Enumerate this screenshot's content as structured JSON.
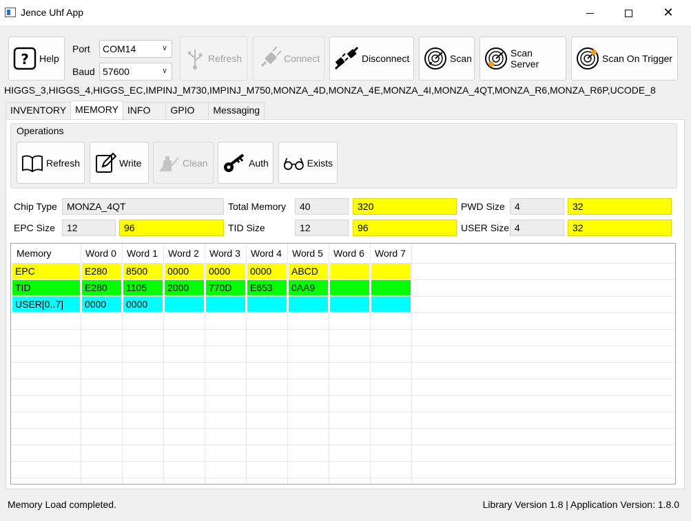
{
  "window": {
    "title": "Jence Uhf App"
  },
  "toolbar": {
    "help_label": "Help",
    "port_label": "Port",
    "port_value": "COM14",
    "baud_label": "Baud",
    "baud_value": "57600",
    "refresh_label": "Refresh",
    "connect_label": "Connect",
    "disconnect_label": "Disconnect",
    "scan_label": "Scan",
    "scan_server_label": "Scan Server",
    "scan_trigger_label": "Scan On Trigger"
  },
  "supported_chips": "HIGGS_3,HIGGS_4,HIGGS_EC,IMPINJ_M730,IMPINJ_M750,MONZA_4D,MONZA_4E,MONZA_4I,MONZA_4QT,MONZA_R6,MONZA_R6P,UCODE_8",
  "tabs": [
    {
      "label": "INVENTORY"
    },
    {
      "label": "MEMORY"
    },
    {
      "label": "INFO"
    },
    {
      "label": "GPIO"
    },
    {
      "label": "Messaging"
    }
  ],
  "operations": {
    "title": "Operations",
    "refresh_label": "Refresh",
    "write_label": "Write",
    "clean_label": "Clean",
    "auth_label": "Auth",
    "exists_label": "Exists"
  },
  "info": {
    "chip_type_label": "Chip Type",
    "chip_type_value": "MONZA_4QT",
    "total_memory_label": "Total Memory",
    "total_memory_words": "40",
    "total_memory_bits": "320",
    "pwd_size_label": "PWD Size",
    "pwd_size_words": "4",
    "pwd_size_bits": "32",
    "epc_size_label": "EPC Size",
    "epc_size_words": "12",
    "epc_size_bits": "96",
    "tid_size_label": "TID Size",
    "tid_size_words": "12",
    "tid_size_bits": "96",
    "user_size_label": "USER Size",
    "user_size_words": "4",
    "user_size_bits": "32"
  },
  "memory_table": {
    "headers": [
      "Memory",
      "Word 0",
      "Word 1",
      "Word 2",
      "Word 3",
      "Word 4",
      "Word 5",
      "Word 6",
      "Word 7"
    ],
    "rows": [
      {
        "cells": [
          "EPC",
          "E280",
          "8500",
          "0000",
          "0000",
          "0000",
          "ABCD",
          "",
          ""
        ],
        "color": "#ffff00"
      },
      {
        "cells": [
          "TID",
          "E280",
          "1105",
          "2000",
          "770D",
          "E653",
          "0AA9",
          "",
          ""
        ],
        "color": "#00ff00"
      },
      {
        "cells": [
          "USER[0..7]",
          "0000",
          "0000",
          "",
          "",
          "",
          "",
          "",
          ""
        ],
        "color": "#00ffff"
      }
    ]
  },
  "status": {
    "message": "Memory Load completed.",
    "version": "Library Version 1.8 | Application Version: 1.8.0"
  }
}
